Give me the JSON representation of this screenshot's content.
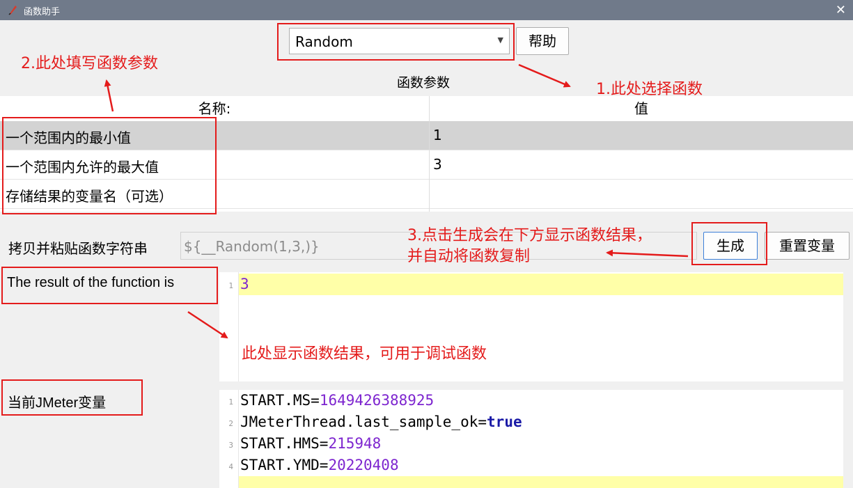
{
  "window": {
    "title": "函数助手",
    "icon": "feather-icon",
    "close_icon": "close-icon"
  },
  "function_select": {
    "value": "Random"
  },
  "help_button": "帮助",
  "params_title": "函数参数",
  "table": {
    "headers": [
      "名称:",
      "值"
    ],
    "rows": [
      {
        "name": "一个范围内的最小值",
        "value": "1",
        "selected": true
      },
      {
        "name": "一个范围内允许的最大值",
        "value": "3",
        "selected": false
      },
      {
        "name": "存储结果的变量名（可选）",
        "value": "",
        "selected": false
      }
    ]
  },
  "copy_label": "拷贝并粘贴函数字符串",
  "function_string": "${__Random(1,3,)}",
  "generate_button": "生成",
  "reset_button": "重置变量",
  "result_label": "The result of the function is",
  "result_lines": [
    {
      "no": "1",
      "text": "3"
    }
  ],
  "vars_label": "当前JMeter变量",
  "variables": [
    {
      "no": "1",
      "key": "START.MS",
      "value": "1649426388925"
    },
    {
      "no": "2",
      "key": "JMeterThread.last_sample_ok",
      "value": "true"
    },
    {
      "no": "3",
      "key": "START.HMS",
      "value": "215948"
    },
    {
      "no": "4",
      "key": "START.YMD",
      "value": "20220408"
    }
  ],
  "annotations": {
    "step1": "1.此处选择函数",
    "step2": "2.此处填写函数参数",
    "step3_line1": "3.点击生成会在下方显示函数结果，",
    "step3_line2": "并自动将函数复制",
    "result_note": "此处显示函数结果，可用于调试函数"
  },
  "colors": {
    "annotation": "#e41b1b",
    "titlebar": "#707a8a",
    "highlight_line": "#ffffa8",
    "number": "#7d25cf",
    "keyword": "#1a1aa6"
  }
}
